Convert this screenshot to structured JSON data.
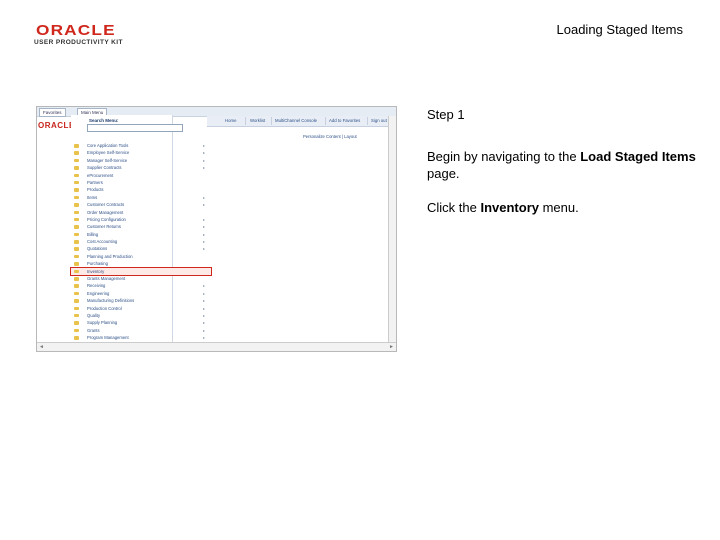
{
  "header": {
    "logo_main": "ORACLE",
    "logo_sub": "USER PRODUCTIVITY KIT",
    "page_title": "Loading Staged Items"
  },
  "step": {
    "title": "Step 1",
    "line1_prefix": "Begin by navigating to the ",
    "line1_bold": "Load Staged Items",
    "line1_suffix": " page.",
    "line2_prefix": "Click the ",
    "line2_bold": "Inventory",
    "line2_suffix": " menu."
  },
  "screenshot": {
    "tabs": [
      "Favorites",
      "Main Menu"
    ],
    "logo": "ORACLE",
    "menu_title": "Search Menu:",
    "nav_links": [
      "Home",
      "Worklist",
      "MultiChannel Console",
      "Add to Favorites",
      "Sign out"
    ],
    "personalize": "Personalize Content | Layout",
    "menu_items": [
      "Core Application Tools",
      "Employee Self-Service",
      "Manager Self-Service",
      "Supplier Contracts",
      "eProcurement",
      "Partners",
      "Products",
      "Items",
      "Customer Contracts",
      "Order Management",
      "Pricing Configuration",
      "Customer Returns",
      "Billing",
      "Cost Accounting",
      "Quotations",
      "Planning and Production",
      "Purchasing",
      "Inventory",
      "Grants Management",
      "Receiving",
      "Engineering",
      "Manufacturing Definitions",
      "Production Control",
      "Quality",
      "Supply Planning",
      "Grants",
      "Program Management",
      "Project Costing"
    ],
    "highlight_index": 17
  },
  "colors": {
    "oracle_red": "#d0271d",
    "link_blue": "#2c4f86",
    "folder_yellow": "#e9c24b"
  }
}
